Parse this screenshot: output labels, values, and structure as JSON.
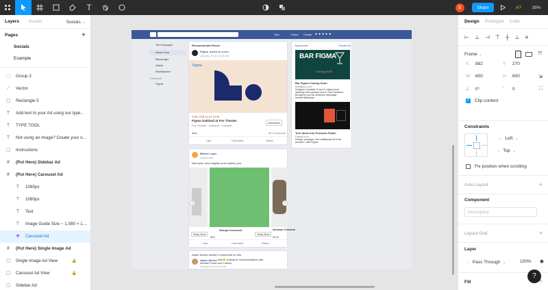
{
  "toolbar": {
    "share_label": "Share",
    "ai_label": "A?",
    "zoom_value": "39%",
    "avatar_initial": "S",
    "accent_color": "#0d99ff",
    "avatar_color": "#f24e1e"
  },
  "left_panel": {
    "tab_layers": "Layers",
    "tab_assets": "Assets",
    "page_selector": "Socials",
    "pages_header": "Pages",
    "pages": [
      "Socials",
      "Example"
    ],
    "layers": [
      {
        "label": "Group 3",
        "icon": "group-icon"
      },
      {
        "label": "Vector",
        "icon": "vector-icon"
      },
      {
        "label": "Rectangle 5",
        "icon": "rectangle-icon"
      },
      {
        "label": "Add text to your Ad using our type...",
        "icon": "text-icon"
      },
      {
        "label": "TYPE TOOL",
        "icon": "text-icon"
      },
      {
        "label": "Not using an image? Create your o...",
        "icon": "text-icon"
      },
      {
        "label": "Instructions",
        "icon": "rectangle-icon"
      },
      {
        "label": "(Put Here) Sidebar Ad",
        "icon": "frame-icon"
      },
      {
        "label": "(Put Here) Carousel Ad",
        "icon": "frame-icon"
      },
      {
        "label": "1080px",
        "icon": "text-icon"
      },
      {
        "label": "1080px",
        "icon": "text-icon"
      },
      {
        "label": "Text",
        "icon": "text-icon"
      },
      {
        "label": "Image Guide Size ~ 1,080 × 1,...",
        "icon": "text-icon"
      },
      {
        "label": "Carousel Ad",
        "icon": "component-icon"
      },
      {
        "label": "(Put Here) Single Image Ad",
        "icon": "frame-icon"
      },
      {
        "label": "Single Image Ad View",
        "icon": "rectangle-icon"
      },
      {
        "label": "Carousel Ad View",
        "icon": "rectangle-icon"
      },
      {
        "label": "Sidebar Ad",
        "icon": "rectangle-icon"
      }
    ]
  },
  "canvas": {
    "fb_nav": [
      "Terri",
      "Home",
      "Create"
    ],
    "sidebar_user": "Terri Samayal",
    "sidebar_items": [
      "News Feed",
      "Messenger",
      "Watch",
      "Marketplace"
    ],
    "shortcuts_label": "Shortcuts",
    "shortcut_item": "Figma",
    "event_card": {
      "header": "Recommended Event",
      "poster": "Figma",
      "poster_action": "added an event.",
      "timestamp": "January 15 at 10:43 AM",
      "image_label": "Figma",
      "date_line": "SUN, FEB 24 AT 8 PM",
      "title": "Figma Oakland at Fox Theater",
      "location": "Fox Theater · Oakland · Oakland",
      "interested": "Interested",
      "comments": "56 Comments",
      "actions": [
        "Like",
        "Comment",
        "Share"
      ]
    },
    "ad_card": {
      "header": "Sponsored",
      "create_ad": "Create Ad",
      "headline": "BAR FIGMA",
      "tagline": "Coming 2035.",
      "title": "Bar Figma Coming Soon",
      "url": "barfigma.com",
      "body": [
        "Designer Cocktails. A new & unique local",
        "watering hole opening soon in San Francisco.",
        "Brought to you by renowned mixologist",
        "Herbert Barnabas."
      ],
      "title2": "Turn Ideas Into Products Faster",
      "url2": "Figma.com",
      "body2": [
        "Design, prototype, and collaborate all in the",
        "browser—with Figma."
      ]
    },
    "carousel_card": {
      "brand": "Marine Layer",
      "sponsored": "Sponsored",
      "text": "New year, new (slightly more stylish) you.",
      "items": [
        {
          "name": "Sherpa Crewneck",
          "price": "$68",
          "cta": "Shop Now"
        },
        {
          "name": "Nicholas Crewneck",
          "price": "$128",
          "cta": "Shop Now"
        }
      ],
      "actions": [
        "Like",
        "Comment",
        "Share"
      ]
    },
    "comment_card": {
      "line1": "Adam Wexler added 5 comments on this.",
      "author": "Adam Wexler",
      "action": "was 🙂 looking for recommendations with",
      "with": "Michael Fourier and 2 others.",
      "timestamp": "January 15 at 10:43 AM"
    }
  },
  "right_panel": {
    "tabs": [
      "Design",
      "Prototype",
      "Code"
    ],
    "frame_label": "Frame",
    "x": "882",
    "y": "270",
    "w": "600",
    "h": "600",
    "rotation": "0°",
    "radius": "0",
    "clip_content": "Clip content",
    "constraints_label": "Constraints",
    "constraint_h": "Left",
    "constraint_v": "Top",
    "fix_position": "Fix position when scrolling",
    "auto_layout": "Auto Layout",
    "component_label": "Component",
    "description_placeholder": "Description",
    "layout_grid": "Layout Grid",
    "layer_label": "Layer",
    "blend_mode": "Pass Through",
    "opacity": "100%",
    "fill_label": "Fill",
    "help": "?"
  }
}
